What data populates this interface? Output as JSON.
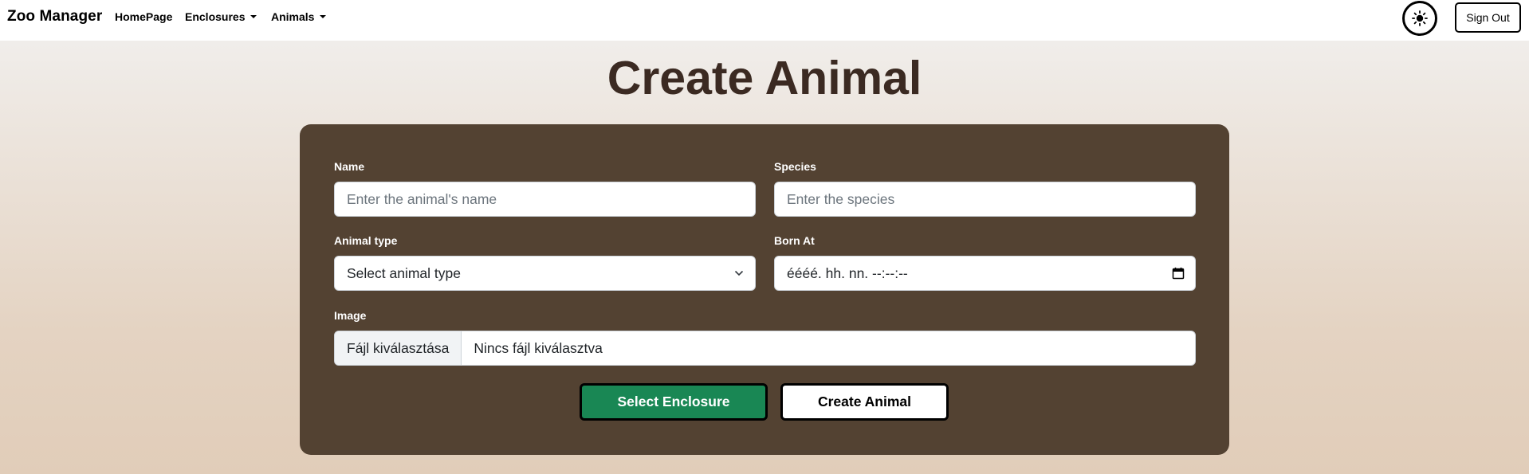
{
  "navbar": {
    "brand": "Zoo Manager",
    "links": [
      {
        "label": "HomePage"
      },
      {
        "label": "Enclosures",
        "dropdown": true
      },
      {
        "label": "Animals",
        "dropdown": true
      }
    ],
    "theme_icon": "sun-icon",
    "signout_label": "Sign Out"
  },
  "page": {
    "title": "Create Animal"
  },
  "form": {
    "name": {
      "label": "Name",
      "placeholder": "Enter the animal's name",
      "value": ""
    },
    "species": {
      "label": "Species",
      "placeholder": "Enter the species",
      "value": ""
    },
    "animal_type": {
      "label": "Animal type",
      "selected": "Select animal type"
    },
    "born_at": {
      "label": "Born At",
      "value": "éééé. hh. nn. --:--:--",
      "icon": "calendar-icon"
    },
    "image": {
      "label": "Image",
      "button_label": "Fájl kiválasztása",
      "status": "Nincs fájl kiválasztva"
    },
    "select_enclosure_label": "Select Enclosure",
    "create_label": "Create Animal"
  },
  "colors": {
    "card_bg": "#534232",
    "title": "#3b2a22",
    "success": "#198754"
  }
}
